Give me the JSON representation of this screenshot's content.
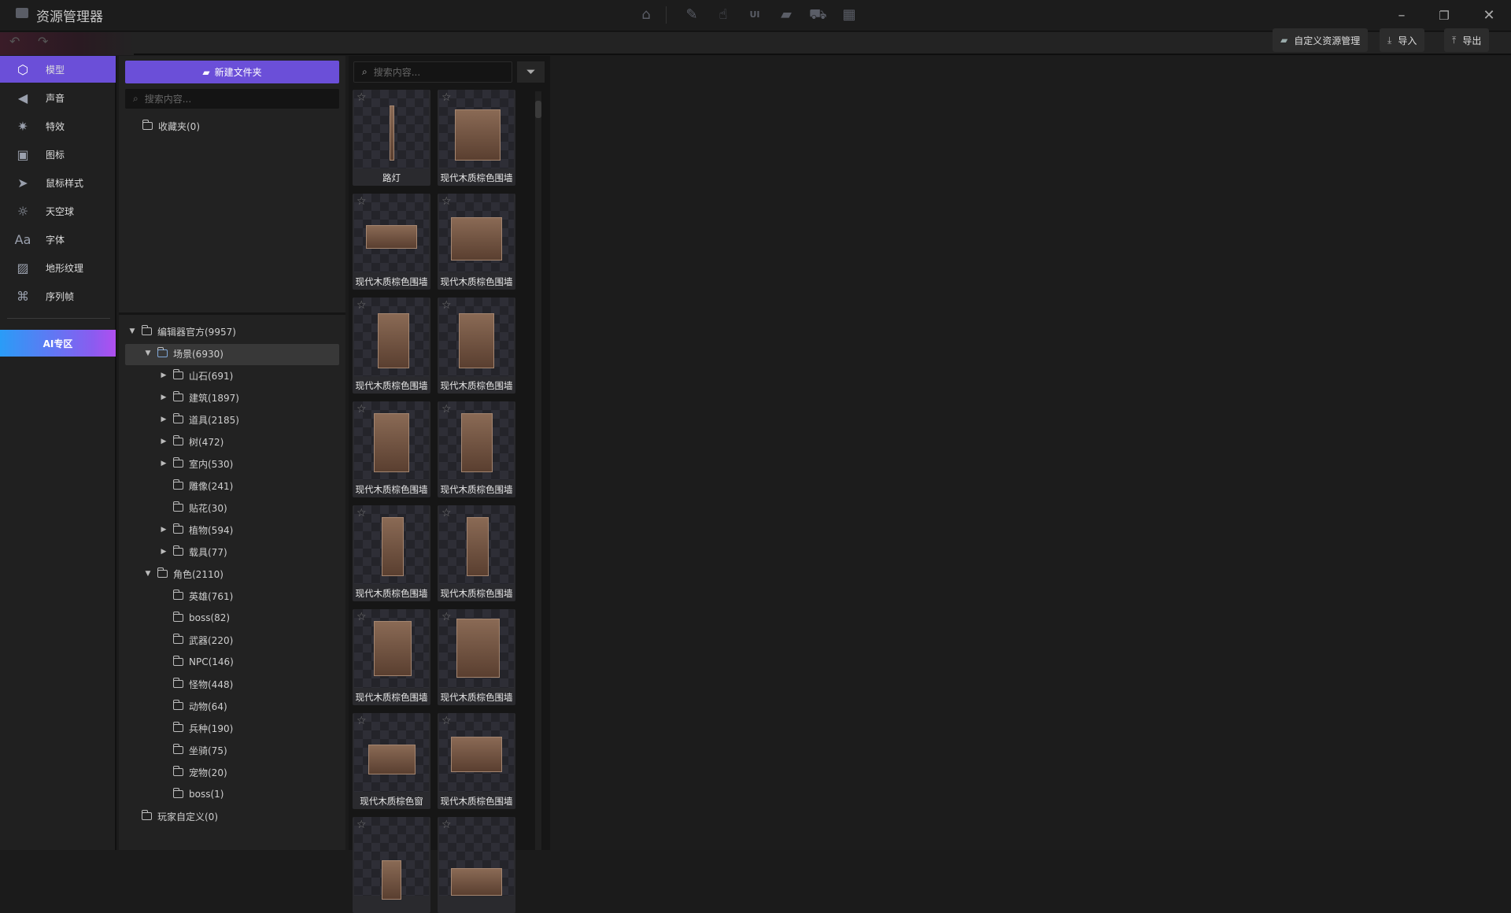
{
  "window": {
    "title": "资源管理器"
  },
  "titlebar_icons": [
    "home-icon",
    "edit-icon",
    "hand-icon",
    "ui-icon",
    "folder-open-icon",
    "cart-icon",
    "grid-icon"
  ],
  "toolbar": {
    "custom_label": "自定义资源管理",
    "import_label": "导入",
    "export_label": "导出"
  },
  "nav": {
    "items": [
      {
        "label": "模型",
        "icon": "cube-icon"
      },
      {
        "label": "声音",
        "icon": "speaker-icon"
      },
      {
        "label": "特效",
        "icon": "sparkle-icon"
      },
      {
        "label": "图标",
        "icon": "image-icon"
      },
      {
        "label": "鼠标样式",
        "icon": "cursor-icon"
      },
      {
        "label": "天空球",
        "icon": "sky-icon"
      },
      {
        "label": "字体",
        "icon": "font-icon"
      },
      {
        "label": "地形纹理",
        "icon": "texture-icon"
      },
      {
        "label": "序列帧",
        "icon": "sequence-icon"
      }
    ],
    "active": "模型",
    "ai_label": "AI专区"
  },
  "folders": {
    "new_folder_label": "新建文件夹",
    "search_placeholder": "搜索内容...",
    "favorites": "收藏夹(0)",
    "tree": [
      {
        "label": "编辑器官方(9957)",
        "level": 0,
        "arrow": "down"
      },
      {
        "label": "场景(6930)",
        "level": 1,
        "arrow": "down",
        "selected": true
      },
      {
        "label": "山石(691)",
        "level": 2,
        "arrow": "right"
      },
      {
        "label": "建筑(1897)",
        "level": 2,
        "arrow": "right"
      },
      {
        "label": "道具(2185)",
        "level": 2,
        "arrow": "right"
      },
      {
        "label": "树(472)",
        "level": 2,
        "arrow": "right"
      },
      {
        "label": "室内(530)",
        "level": 2,
        "arrow": "right"
      },
      {
        "label": "雕像(241)",
        "level": 2,
        "arrow": ""
      },
      {
        "label": "贴花(30)",
        "level": 2,
        "arrow": ""
      },
      {
        "label": "植物(594)",
        "level": 2,
        "arrow": "right"
      },
      {
        "label": "载具(77)",
        "level": 2,
        "arrow": "right"
      },
      {
        "label": "角色(2110)",
        "level": 1,
        "arrow": "down"
      },
      {
        "label": "英雄(761)",
        "level": 2,
        "arrow": ""
      },
      {
        "label": "boss(82)",
        "level": 2,
        "arrow": ""
      },
      {
        "label": "武器(220)",
        "level": 2,
        "arrow": ""
      },
      {
        "label": "NPC(146)",
        "level": 2,
        "arrow": ""
      },
      {
        "label": "怪物(448)",
        "level": 2,
        "arrow": ""
      },
      {
        "label": "动物(64)",
        "level": 2,
        "arrow": ""
      },
      {
        "label": "兵种(190)",
        "level": 2,
        "arrow": ""
      },
      {
        "label": "坐骑(75)",
        "level": 2,
        "arrow": ""
      },
      {
        "label": "宠物(20)",
        "level": 2,
        "arrow": ""
      },
      {
        "label": "boss(1)",
        "level": 2,
        "arrow": ""
      },
      {
        "label": "玩家自定义(0)",
        "level": 0,
        "arrow": ""
      }
    ]
  },
  "assets": {
    "search_placeholder": "搜索内容...",
    "tiles": [
      "路灯",
      "现代木质棕色围墙",
      "现代木质棕色围墙",
      "现代木质棕色围墙",
      "现代木质棕色围墙",
      "现代木质棕色围墙",
      "现代木质棕色围墙",
      "现代木质棕色围墙",
      "现代木质棕色围墙",
      "现代木质棕色围墙",
      "现代木质棕色围墙",
      "现代木质棕色围墙",
      "现代木质棕色窗",
      "现代木质棕色围墙",
      "",
      ""
    ]
  }
}
